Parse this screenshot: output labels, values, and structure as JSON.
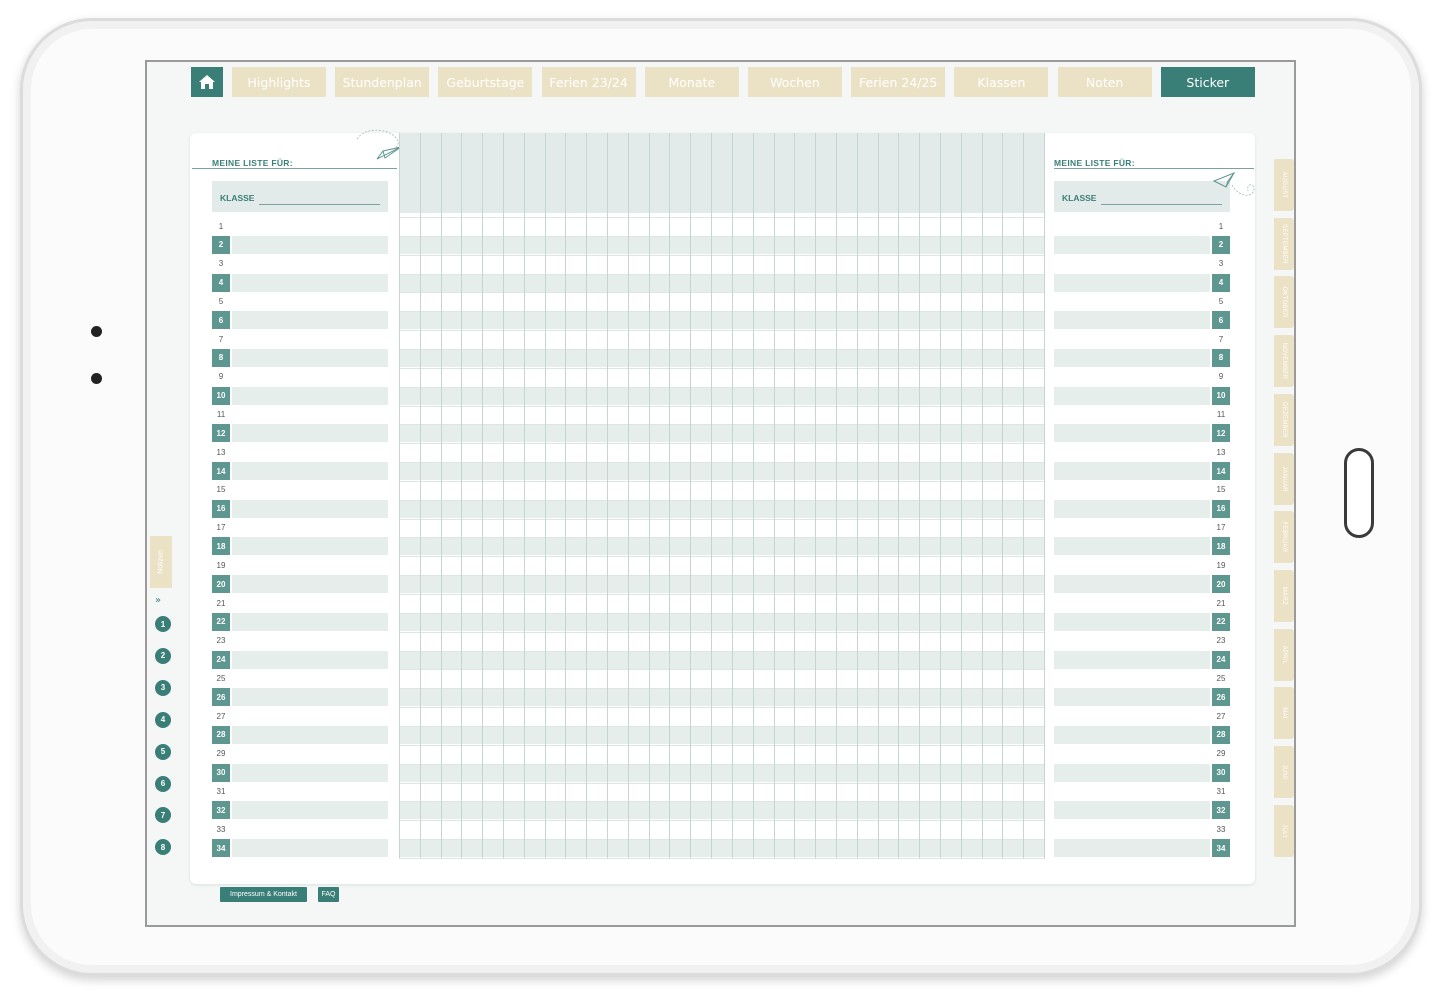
{
  "nav": {
    "home_icon": "home-icon",
    "tabs": [
      {
        "label": "Highlights",
        "active": false
      },
      {
        "label": "Stundenplan",
        "active": false
      },
      {
        "label": "Geburtstage",
        "active": false
      },
      {
        "label": "Ferien 23/24",
        "active": false
      },
      {
        "label": "Monate",
        "active": false
      },
      {
        "label": "Wochen",
        "active": false
      },
      {
        "label": "Ferien 24/25",
        "active": false
      },
      {
        "label": "Klassen",
        "active": false
      },
      {
        "label": "Noten",
        "active": false
      },
      {
        "label": "Sticker",
        "active": true
      }
    ]
  },
  "left_panel": {
    "title": "MEINE LISTE FÜR:",
    "class_label": "KLASSE"
  },
  "right_panel": {
    "title": "MEINE LISTE FÜR:",
    "class_label": "KLASSE"
  },
  "row_numbers": [
    "1",
    "2",
    "3",
    "4",
    "5",
    "6",
    "7",
    "8",
    "9",
    "10",
    "11",
    "12",
    "13",
    "14",
    "15",
    "16",
    "17",
    "18",
    "19",
    "20",
    "21",
    "22",
    "23",
    "24",
    "25",
    "26",
    "27",
    "28",
    "29",
    "30",
    "31",
    "32",
    "33",
    "34"
  ],
  "side_nav": {
    "notes_label": "Notizen",
    "chevron": "»",
    "pages": [
      "1",
      "2",
      "3",
      "4",
      "5",
      "6",
      "7",
      "8"
    ]
  },
  "months": [
    "AUGUST",
    "SEPTEMBER",
    "OKTOBER",
    "NOVEMBER",
    "DEZEMBER",
    "JANUAR",
    "FEBRUAR",
    "MÄRZ",
    "APRIL",
    "MAI",
    "JUNI",
    "JULI"
  ],
  "footer": {
    "impressum": "Impressum & Kontakt",
    "faq": "FAQ"
  },
  "colors": {
    "accent": "#3a7f77",
    "tab": "#ebe2c6",
    "row_shade": "#e6eeec"
  }
}
